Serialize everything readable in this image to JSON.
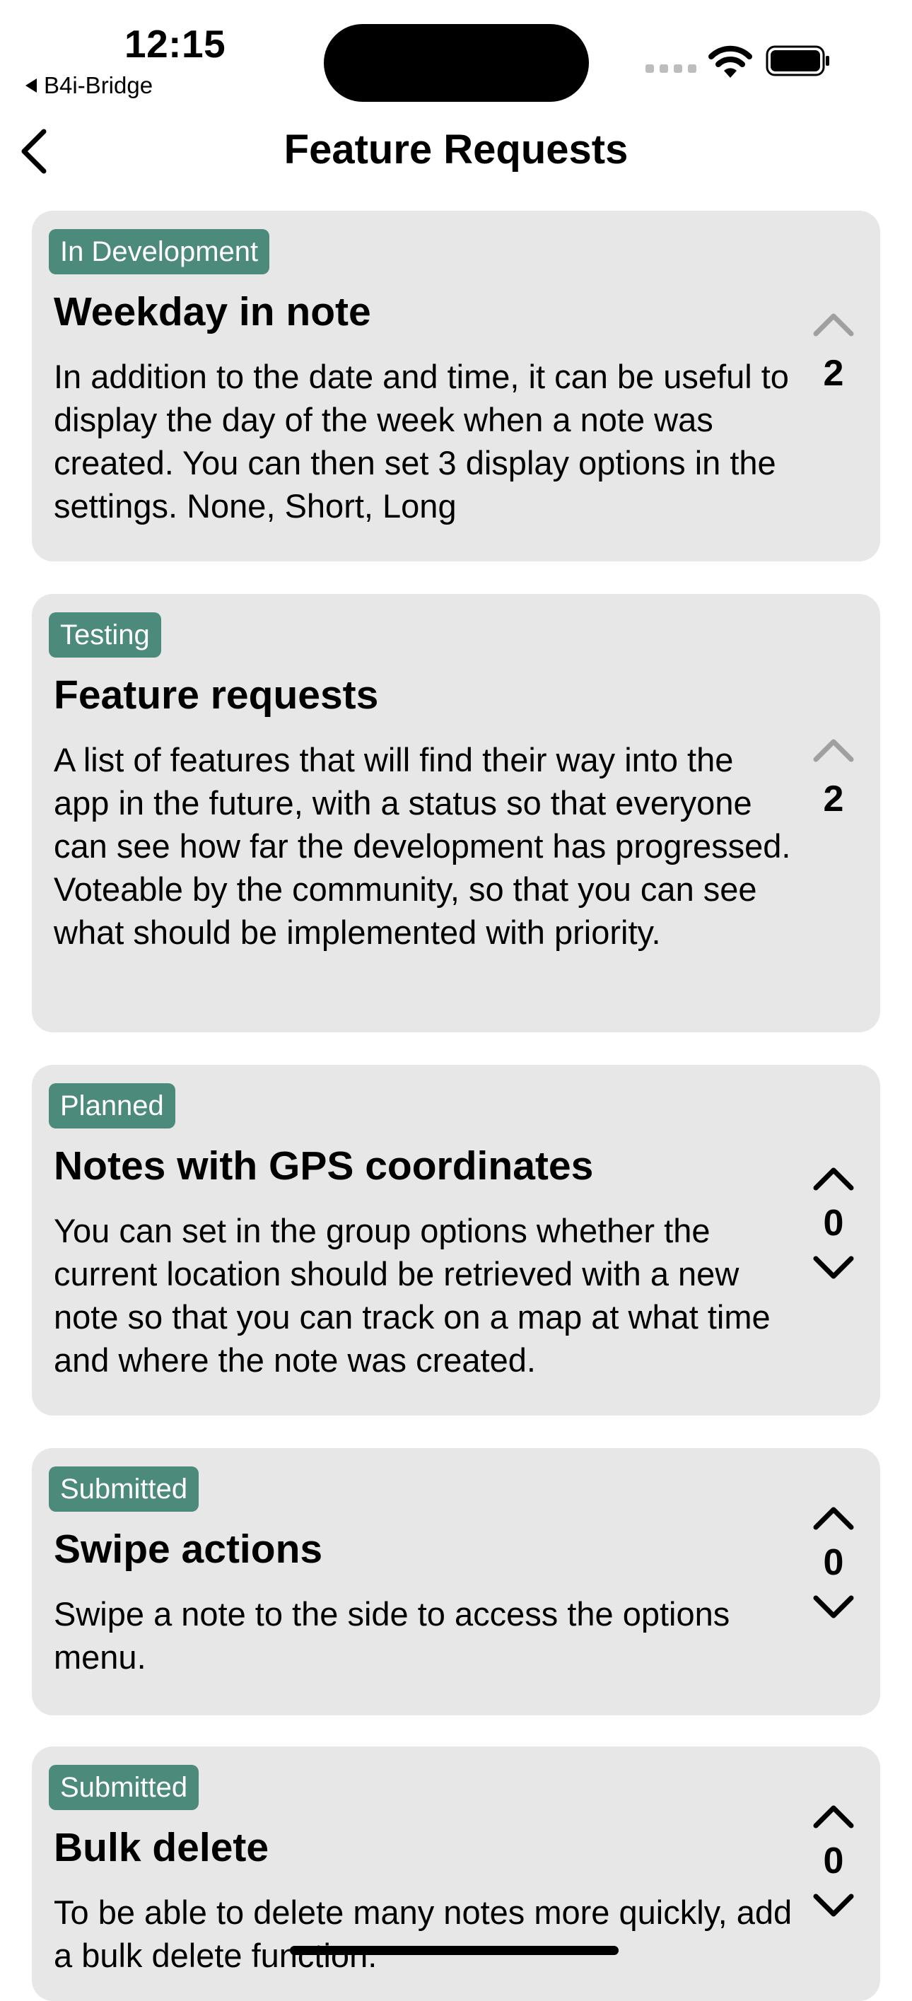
{
  "status_bar": {
    "time": "12:15",
    "back_app": "B4i-Bridge",
    "icons": [
      "cellular-signal-icon",
      "wifi-icon",
      "battery-icon"
    ]
  },
  "nav": {
    "title": "Feature Requests",
    "back_icon": "chevron-left-icon"
  },
  "colors": {
    "badge_bg": "#4c8a7c",
    "card_bg": "#e7e7e7",
    "disabled_arrow": "#a0a0a0"
  },
  "requests": [
    {
      "status": "In Development",
      "title": "Weekday in note",
      "description": "In addition to the date and time, it can be useful to display the day of the week when a note was created. You can then set 3 display options in the settings. None, Short, Long",
      "votes": "2",
      "upvote_active": false,
      "downvote_visible": false
    },
    {
      "status": "Testing",
      "title": "Feature requests",
      "description": "A list of features that will find their way into the app in the future, with a status so that everyone can see how far the development has progressed. Voteable by the community, so that you can see what should be implemented with priority.",
      "votes": "2",
      "upvote_active": false,
      "downvote_visible": false
    },
    {
      "status": "Planned",
      "title": "Notes with GPS coordinates",
      "description": "You can set in the group options whether the current location should be retrieved with a new note so that you can track on a map at what time and where the note was created.",
      "votes": "0",
      "upvote_active": true,
      "downvote_visible": true
    },
    {
      "status": "Submitted",
      "title": "Swipe actions",
      "description": "Swipe a note to the side to access the options menu.",
      "votes": "0",
      "upvote_active": true,
      "downvote_visible": true
    },
    {
      "status": "Submitted",
      "title": "Bulk delete",
      "description": "To be able to delete many notes more quickly, add a bulk delete function.",
      "votes": "0",
      "upvote_active": true,
      "downvote_visible": true
    }
  ]
}
